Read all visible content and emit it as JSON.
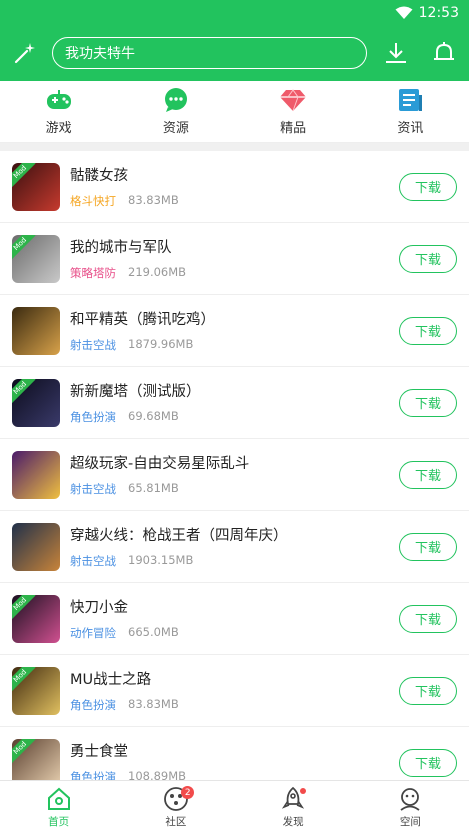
{
  "status": {
    "time": "12:53"
  },
  "header": {
    "search_text": "我功夫特牛"
  },
  "categories": [
    {
      "label": "游戏",
      "icon": "gamepad-icon"
    },
    {
      "label": "资源",
      "icon": "chat-bubble-icon"
    },
    {
      "label": "精品",
      "icon": "diamond-icon"
    },
    {
      "label": "资讯",
      "icon": "news-icon"
    }
  ],
  "apps": [
    {
      "name": "骷髅女孩",
      "category": "格斗快打",
      "category_color": "#f5a623",
      "size": "83.83MB",
      "button": "下载",
      "mod": true,
      "icon_colors": [
        "#3a1010",
        "#c63a2e"
      ]
    },
    {
      "name": "我的城市与军队",
      "category": "策略塔防",
      "category_color": "#e8508a",
      "size": "219.06MB",
      "button": "下载",
      "mod": true,
      "icon_colors": [
        "#6b6b6b",
        "#c9c9c9"
      ]
    },
    {
      "name": "和平精英（腾讯吃鸡）",
      "category": "射击空战",
      "category_color": "#4a90e2",
      "size": "1879.96MB",
      "button": "下载",
      "mod": false,
      "icon_colors": [
        "#3a2a10",
        "#d8a24a"
      ]
    },
    {
      "name": "新新魔塔（测试版）",
      "category": "角色扮演",
      "category_color": "#4a90e2",
      "size": "69.68MB",
      "button": "下载",
      "mod": true,
      "icon_colors": [
        "#0c0c1c",
        "#3a3a6a"
      ]
    },
    {
      "name": "超级玩家-自由交易星际乱斗",
      "category": "射击空战",
      "category_color": "#4a90e2",
      "size": "65.81MB",
      "button": "下载",
      "mod": false,
      "icon_colors": [
        "#4a1a6a",
        "#f0c040"
      ]
    },
    {
      "name": "穿越火线：枪战王者（四周年庆）",
      "category": "射击空战",
      "category_color": "#4a90e2",
      "size": "1903.15MB",
      "button": "下载",
      "mod": false,
      "icon_colors": [
        "#20304a",
        "#c8843a"
      ]
    },
    {
      "name": "快刀小金",
      "category": "动作冒险",
      "category_color": "#4a90e2",
      "size": "665.0MB",
      "button": "下载",
      "mod": true,
      "icon_colors": [
        "#1a1020",
        "#d05090"
      ]
    },
    {
      "name": "MU战士之路",
      "category": "角色扮演",
      "category_color": "#4a90e2",
      "size": "83.83MB",
      "button": "下载",
      "mod": true,
      "icon_colors": [
        "#402a10",
        "#e0c060"
      ]
    },
    {
      "name": "勇士食堂",
      "category": "角色扮演",
      "category_color": "#4a90e2",
      "size": "108.89MB",
      "button": "下载",
      "mod": true,
      "icon_colors": [
        "#5a4030",
        "#e8d0b0"
      ]
    }
  ],
  "tabs": [
    {
      "label": "首页",
      "icon": "home-icon",
      "active": true
    },
    {
      "label": "社区",
      "icon": "community-icon",
      "badge": "2"
    },
    {
      "label": "发现",
      "icon": "rocket-icon",
      "dot": true
    },
    {
      "label": "空间",
      "icon": "profile-icon"
    }
  ],
  "colors": {
    "brand": "#22c35e"
  }
}
